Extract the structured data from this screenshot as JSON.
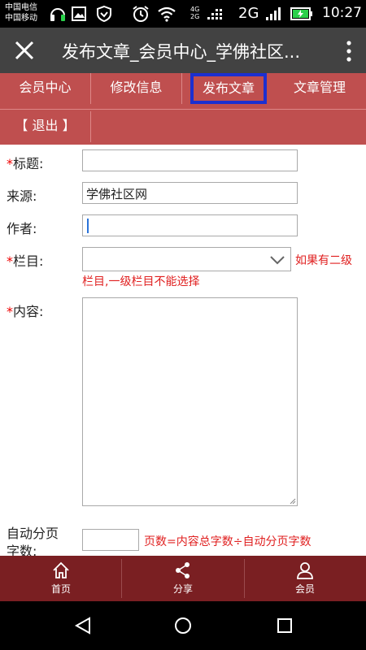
{
  "status_bar": {
    "carrier_1": "中国电信",
    "carrier_2": "中国移动",
    "network_small": "4G\n2G",
    "network": "2G",
    "time": "10:27"
  },
  "app_bar": {
    "title": "发布文章_会员中心_学佛社区..."
  },
  "nav": {
    "items": [
      {
        "label": "会员中心"
      },
      {
        "label": "修改信息"
      },
      {
        "label": "发布文章"
      },
      {
        "label": "文章管理"
      },
      {
        "label": "【 退出 】"
      }
    ]
  },
  "form": {
    "title_label": "标题:",
    "source_label": "来源:",
    "source_value": "学佛社区网",
    "author_label": "作者:",
    "column_label": "栏目:",
    "column_hint_1": "如果有二级",
    "column_hint_2": "栏目,一级栏目不能选择",
    "content_label": "内容:",
    "autopage_label_1": "自动分页",
    "autopage_label_2": "字数:",
    "autopage_hint": "页数=内容总字数÷自动分页字数",
    "required_mark": "*"
  },
  "bottom_bar": {
    "home": "首页",
    "share": "分享",
    "member": "会员"
  },
  "colors": {
    "nav_bg": "#bf4f4f",
    "active_border": "#1c2fd0",
    "bottom_bg": "#7a1f22",
    "hint": "#e02020"
  }
}
